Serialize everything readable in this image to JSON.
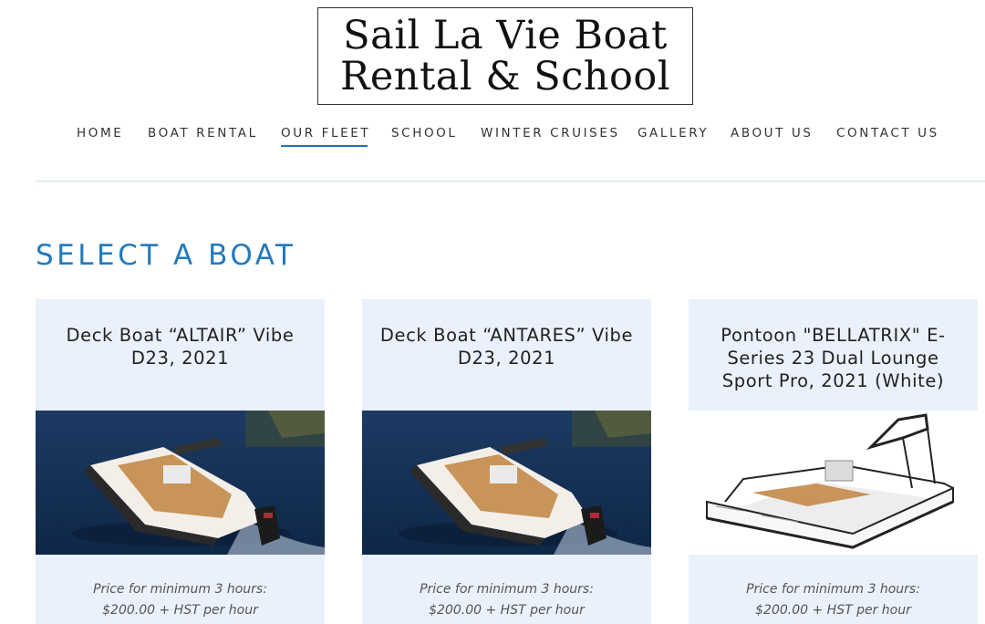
{
  "header": {
    "logo_line1": "Sail La Vie Boat",
    "logo_line2": "Rental & School"
  },
  "nav": {
    "items": [
      "HOME",
      "BOAT RENTAL",
      "OUR FLEET",
      "SCHOOL",
      "WINTER CRUISES",
      "GALLERY",
      "ABOUT US",
      "CONTACT US"
    ],
    "active": "OUR FLEET"
  },
  "main": {
    "section_title": "SELECT A BOAT",
    "cards": [
      {
        "title": "Deck Boat “ALTAIR” Vibe D23, 2021",
        "image_icon": "deck-boat-photo",
        "price_line1": "Price for minimum 3 hours:",
        "price_line2": "$200.00 + HST per hour"
      },
      {
        "title": "Deck Boat “ANTARES” Vibe D23, 2021",
        "image_icon": "deck-boat-photo",
        "price_line1": "Price for minimum 3 hours:",
        "price_line2": "$200.00 + HST per hour"
      },
      {
        "title": "Pontoon \"BELLATRIX\" E-Series 23 Dual Lounge Sport Pro, 2021 (White)",
        "image_icon": "pontoon-boat-photo",
        "price_line1": "Price for minimum 3 hours:",
        "price_line2": "$200.00 + HST per hour"
      }
    ]
  },
  "colors": {
    "accent": "#2379bd",
    "card_bg": "#eaf1fc",
    "divider": "#cfe0ea"
  }
}
